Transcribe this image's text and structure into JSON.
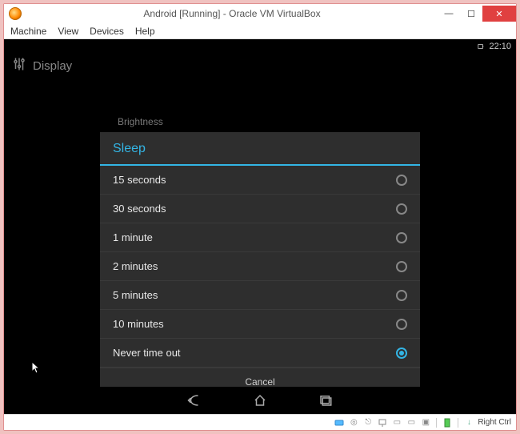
{
  "virtualbox": {
    "title": "Android [Running] - Oracle VM VirtualBox",
    "menu": [
      "Machine",
      "View",
      "Devices",
      "Help"
    ],
    "host_key": "Right Ctrl"
  },
  "android": {
    "time": "22:10",
    "screen_title": "Display",
    "background_label": "Brightness"
  },
  "dialog": {
    "title": "Sleep",
    "options": [
      {
        "label": "15 seconds",
        "selected": false
      },
      {
        "label": "30 seconds",
        "selected": false
      },
      {
        "label": "1 minute",
        "selected": false
      },
      {
        "label": "2 minutes",
        "selected": false
      },
      {
        "label": "5 minutes",
        "selected": false
      },
      {
        "label": "10 minutes",
        "selected": false
      },
      {
        "label": "Never time out",
        "selected": true
      }
    ],
    "cancel": "Cancel"
  }
}
